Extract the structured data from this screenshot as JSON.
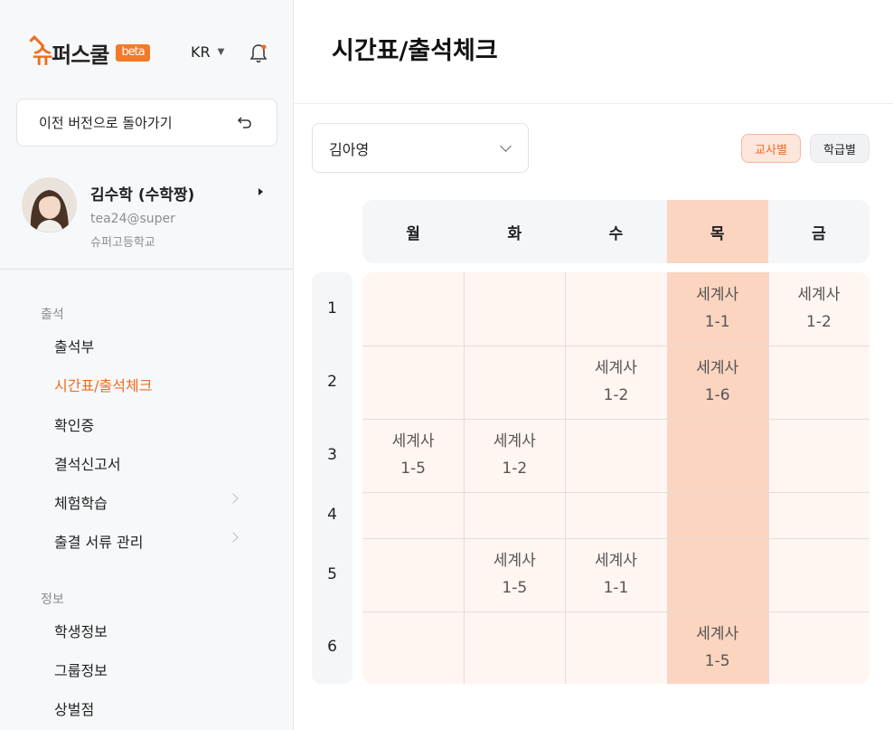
{
  "sidebar": {
    "logo": {
      "part1": "슈",
      "part2": "퍼스쿨",
      "badge": "beta"
    },
    "language": "KR",
    "back_button": "이전 버전으로 돌아가기",
    "profile": {
      "name": "김수학 (수학짱)",
      "email": "tea24@super",
      "school": "슈퍼고등학교"
    },
    "sections": [
      {
        "title": "출석",
        "items": [
          "출석부",
          "시간표/출석체크",
          "확인증",
          "결석신고서",
          "체험학습",
          "출결 서류 관리"
        ]
      },
      {
        "title": "정보",
        "items": [
          "학생정보",
          "그룹정보",
          "상벌점"
        ]
      }
    ],
    "active_item": "시간표/출석체크"
  },
  "main": {
    "title": "시간표/출석체크",
    "teacher": "김아영",
    "toggles": {
      "by_teacher": "교사별",
      "by_class": "학급별",
      "selected": "교사별"
    },
    "timetable": {
      "days": [
        "월",
        "화",
        "수",
        "목",
        "금"
      ],
      "highlighted_day": "목",
      "periods": [
        "1",
        "2",
        "3",
        "4",
        "5",
        "6"
      ],
      "cells": [
        {
          "period": 1,
          "day": "목",
          "subject": "세계사",
          "class": "1-1"
        },
        {
          "period": 1,
          "day": "금",
          "subject": "세계사",
          "class": "1-2"
        },
        {
          "period": 2,
          "day": "수",
          "subject": "세계사",
          "class": "1-2"
        },
        {
          "period": 2,
          "day": "목",
          "subject": "세계사",
          "class": "1-6"
        },
        {
          "period": 3,
          "day": "월",
          "subject": "세계사",
          "class": "1-5"
        },
        {
          "period": 3,
          "day": "화",
          "subject": "세계사",
          "class": "1-2"
        },
        {
          "period": 5,
          "day": "화",
          "subject": "세계사",
          "class": "1-5"
        },
        {
          "period": 5,
          "day": "수",
          "subject": "세계사",
          "class": "1-1"
        },
        {
          "period": 6,
          "day": "목",
          "subject": "세계사",
          "class": "1-5"
        }
      ]
    }
  },
  "colors": {
    "accent": "#f26b1f",
    "highlight": "#fcd5c0",
    "grid_bg": "#fff5f1"
  },
  "icons": {
    "bell": "bell-icon",
    "undo": "undo-icon",
    "dropdown": "chevron-down-icon"
  }
}
